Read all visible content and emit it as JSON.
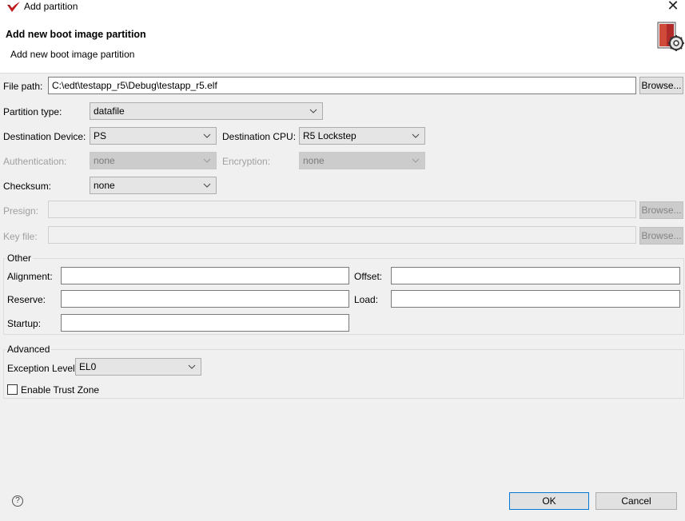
{
  "window": {
    "title": "Add partition",
    "close_glyph": "✕"
  },
  "header": {
    "title": "Add new boot image partition",
    "description": "Add new boot image partition"
  },
  "file_path": {
    "label": "File path:",
    "value": "C:\\edt\\testapp_r5\\Debug\\testapp_r5.elf",
    "browse": "Browse..."
  },
  "partition_type": {
    "label": "Partition type:",
    "value": "datafile"
  },
  "destination_device": {
    "label": "Destination Device:",
    "value": "PS"
  },
  "destination_cpu": {
    "label": "Destination CPU:",
    "value": "R5 Lockstep"
  },
  "authentication": {
    "label": "Authentication:",
    "value": "none"
  },
  "encryption": {
    "label": "Encryption:",
    "value": "none"
  },
  "checksum": {
    "label": "Checksum:",
    "value": "none"
  },
  "presign": {
    "label": "Presign:",
    "value": "",
    "browse": "Browse..."
  },
  "key_file": {
    "label": "Key file:",
    "value": "",
    "browse": "Browse..."
  },
  "other": {
    "title": "Other",
    "alignment": {
      "label": "Alignment:",
      "value": ""
    },
    "offset": {
      "label": "Offset:",
      "value": ""
    },
    "reserve": {
      "label": "Reserve:",
      "value": ""
    },
    "load": {
      "label": "Load:",
      "value": ""
    },
    "startup": {
      "label": "Startup:",
      "value": ""
    }
  },
  "advanced": {
    "title": "Advanced",
    "exception_level": {
      "label": "Exception Level",
      "value": "EL0"
    },
    "trust_zone": {
      "label": "Enable Trust Zone",
      "checked": false
    }
  },
  "footer": {
    "help_glyph": "?",
    "ok": "OK",
    "cancel": "Cancel"
  },
  "icons": {
    "app": "vivado-logo-icon",
    "wizard": "wizard-gear-icon",
    "help": "help-icon",
    "dropdown": "chevron-down-icon"
  },
  "colors": {
    "accent": "#0078d7",
    "disabled_text": "#a0a0a0"
  }
}
